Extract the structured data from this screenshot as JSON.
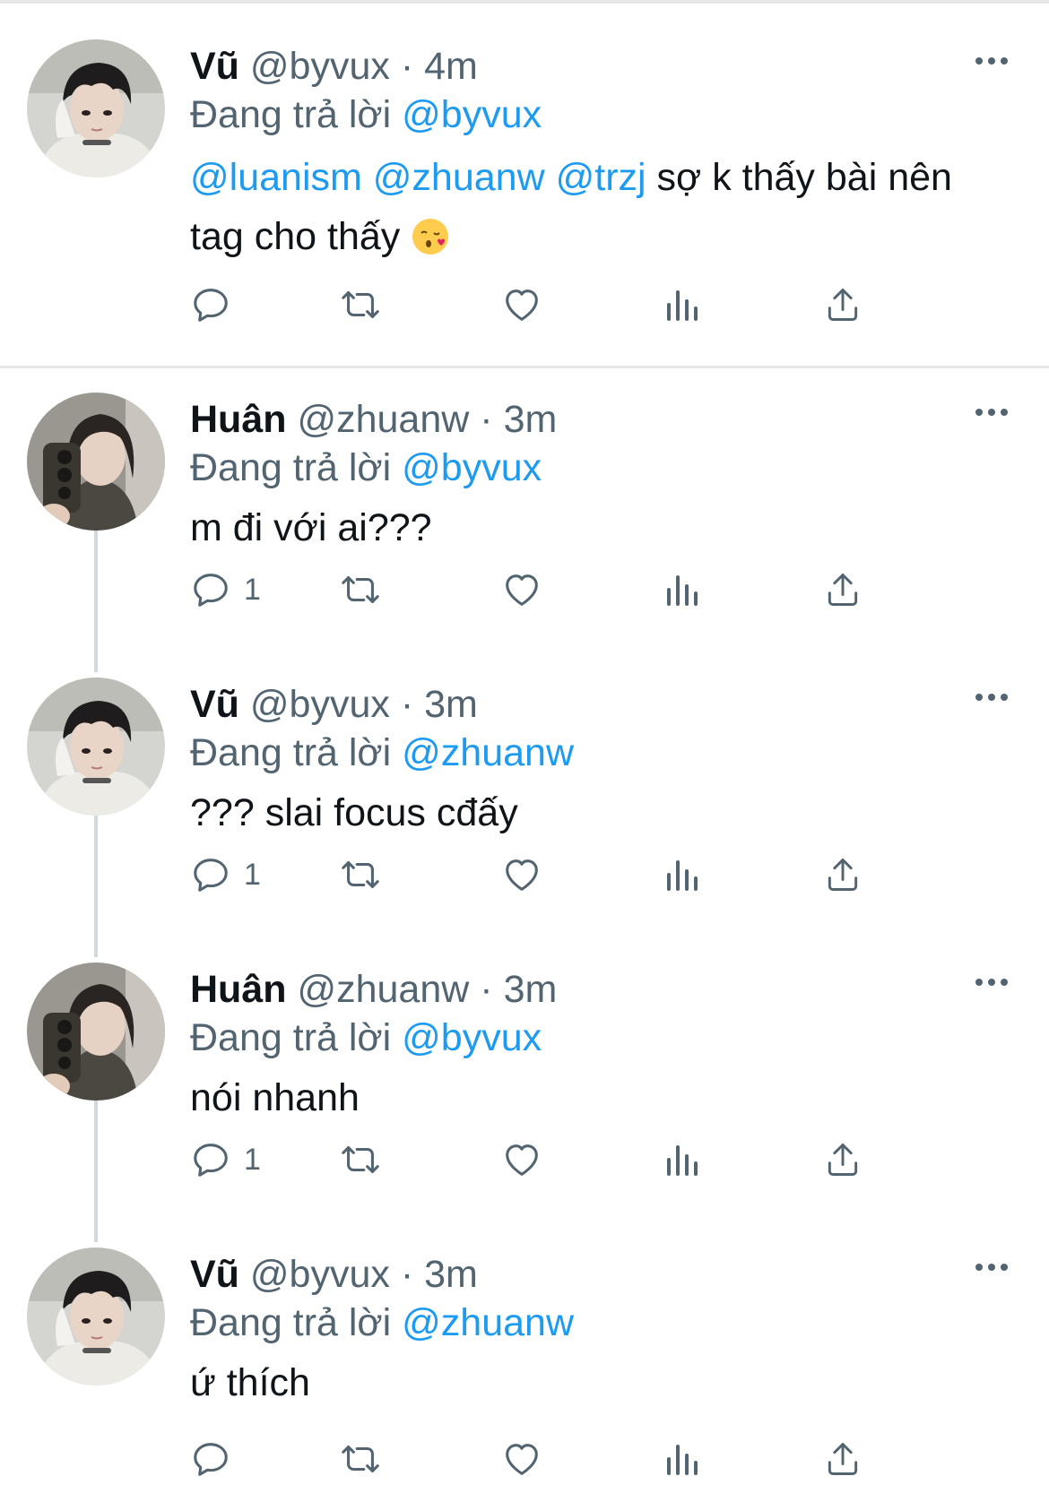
{
  "reply_prefix": "Đang trả lời",
  "separator": "·",
  "tweets": [
    {
      "name": "Vũ",
      "handle": "@byvux",
      "time": "4m",
      "reply_to": "@byvux",
      "mentions": [
        "@luanism",
        "@zhuanw",
        "@trzj"
      ],
      "text": "sợ k thấy bài nên tag cho thấy",
      "emoji": "kissing-face-with-heart-emoji",
      "reply_count": "",
      "avatar": "avatar-vu"
    },
    {
      "name": "Huân",
      "handle": "@zhuanw",
      "time": "3m",
      "reply_to": "@byvux",
      "text": "m đi với ai???",
      "reply_count": "1",
      "avatar": "avatar-huan"
    },
    {
      "name": "Vũ",
      "handle": "@byvux",
      "time": "3m",
      "reply_to": "@zhuanw",
      "text": "??? slai focus cđấy",
      "reply_count": "1",
      "avatar": "avatar-vu"
    },
    {
      "name": "Huân",
      "handle": "@zhuanw",
      "time": "3m",
      "reply_to": "@byvux",
      "text": "nói nhanh",
      "reply_count": "1",
      "avatar": "avatar-huan"
    },
    {
      "name": "Vũ",
      "handle": "@byvux",
      "time": "3m",
      "reply_to": "@zhuanw",
      "text": "ứ thích",
      "reply_count": "",
      "avatar": "avatar-vu"
    }
  ],
  "icons": {
    "reply": "reply-icon",
    "retweet": "retweet-icon",
    "like": "heart-icon",
    "views": "views-icon",
    "share": "share-icon",
    "more": "more-dots-icon"
  },
  "colors": {
    "link": "#1d9bf0",
    "secondary_text": "#536471",
    "primary_text": "#0f1419",
    "thread_line": "#cfd9de"
  }
}
